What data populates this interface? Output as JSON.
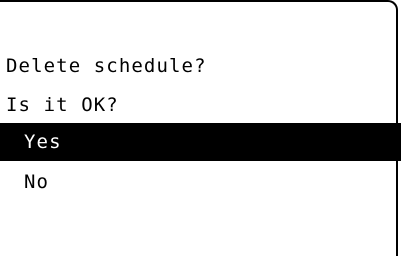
{
  "dialog": {
    "message": "Delete schedule?",
    "question": "Is it OK?",
    "options": [
      {
        "label": "Yes",
        "selected": true
      },
      {
        "label": "No",
        "selected": false
      }
    ]
  },
  "colors": {
    "background": "#ffffff",
    "text": "#000000",
    "highlight_background": "#000000",
    "highlight_text": "#ffffff"
  }
}
